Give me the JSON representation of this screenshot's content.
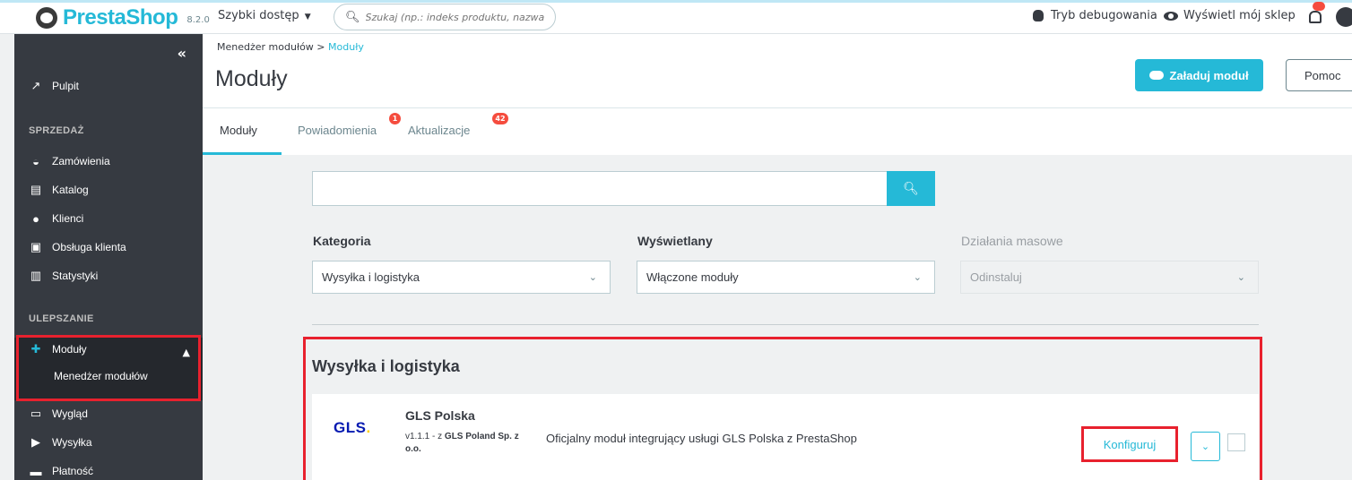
{
  "topbar": {
    "logo_text": "PrestaShop",
    "version": "8.2.0",
    "quick_access": "Szybki dostęp",
    "search_placeholder": "Szukaj (np.: indeks produktu, nazwa ki",
    "debug_label": "Tryb debugowania",
    "view_shop_label": "Wyświetl mój sklep"
  },
  "sidebar": {
    "collapse_glyph": "«",
    "items_top": [
      {
        "label": "Pulpit",
        "icon": "trending-up-icon"
      }
    ],
    "section_sales": "SPRZEDAŻ",
    "sales_items": [
      {
        "label": "Zamówienia",
        "icon": "basket-icon"
      },
      {
        "label": "Katalog",
        "icon": "store-icon"
      },
      {
        "label": "Klienci",
        "icon": "user-icon"
      },
      {
        "label": "Obsługa klienta",
        "icon": "chat-icon"
      },
      {
        "label": "Statystyki",
        "icon": "stats-icon"
      }
    ],
    "section_improve": "ULEPSZANIE",
    "modules_label": "Moduły",
    "modules_sub": "Menedżer modułów",
    "improve_items": [
      {
        "label": "Wygląd",
        "icon": "monitor-icon"
      },
      {
        "label": "Wysyłka",
        "icon": "truck-icon"
      },
      {
        "label": "Płatność",
        "icon": "card-icon"
      }
    ]
  },
  "header": {
    "breadcrumb_parent": "Menedżer modułów",
    "breadcrumb_sep": ">",
    "breadcrumb_current": "Moduły",
    "title": "Moduły",
    "upload_button": "Załaduj moduł",
    "help_button": "Pomoc",
    "tabs": [
      {
        "label": "Moduły",
        "active": true
      },
      {
        "label": "Powiadomienia",
        "badge": "1"
      },
      {
        "label": "Aktualizacje",
        "badge": "42"
      }
    ]
  },
  "filters": {
    "search_value": "",
    "category_label": "Kategoria",
    "category_value": "Wysyłka i logistyka",
    "display_label": "Wyświetlany",
    "display_value": "Włączone moduły",
    "bulk_label": "Działania masowe",
    "bulk_value": "Odinstaluj"
  },
  "category": {
    "title": "Wysyłka i logistyka",
    "modules": [
      {
        "logo_text": "GLS",
        "name": "GLS Polska",
        "version_prefix": "v1.1.1 - z",
        "author": "GLS Poland Sp. z o.o.",
        "description": "Oficjalny moduł integrujący usługi GLS Polska z PrestaShop",
        "configure_label": "Konfiguruj"
      }
    ]
  },
  "colors": {
    "accent": "#25b9d7",
    "sidebar_bg": "#363a41",
    "highlight": "#e8212e",
    "badge": "#f54c3e"
  }
}
